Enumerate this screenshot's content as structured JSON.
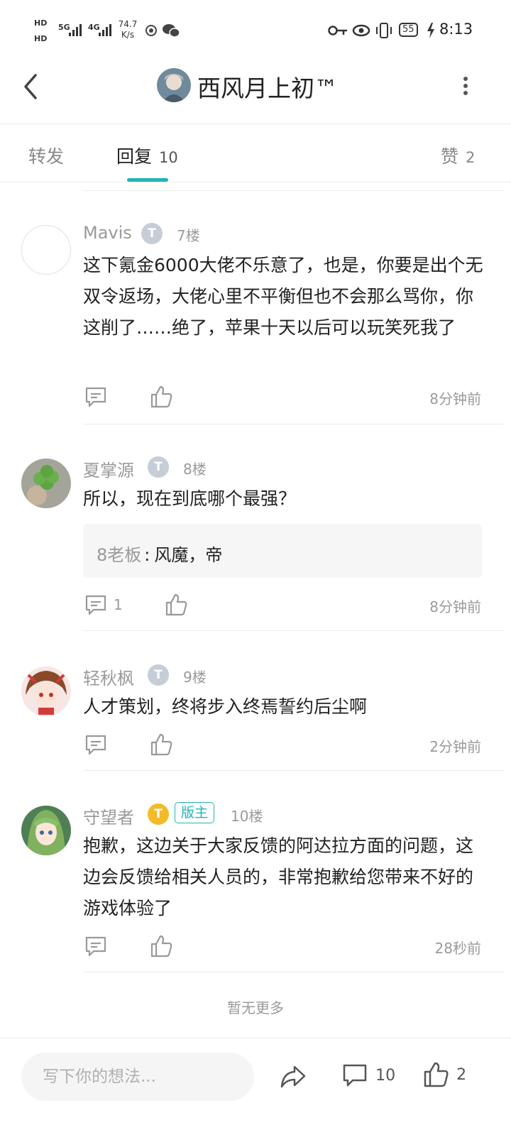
{
  "status_bar": {
    "hd1": "HD",
    "hd2": "HD",
    "sig1": "5G",
    "sig2": "4G",
    "speed": "74.7",
    "speed_unit": "K/s",
    "battery": "55",
    "time": "8:13"
  },
  "header": {
    "title": "西风月上初™"
  },
  "tabs": [
    {
      "label": "转发",
      "count": ""
    },
    {
      "label": "回复",
      "count": "10"
    },
    {
      "label": "赞",
      "count": "2"
    }
  ],
  "comments": [
    {
      "user": "Mavis",
      "level": "T",
      "floor": "7楼",
      "text": "这下氪金6000大佬不乐意了，也是，你要是出个无双令返场，大佬心里不平衡但也不会那么骂你，你这削了……绝了，苹果十天以后可以玩笑死我了",
      "reply_count": "",
      "time": "8分钟前"
    },
    {
      "user": "夏掌源",
      "level": "T",
      "floor": "8楼",
      "text": "所以，现在到底哪个最强？",
      "quote_name": "8老板",
      "quote_sep": ":",
      "quote_text": "风魔，帝",
      "reply_count": "1",
      "time": "8分钟前"
    },
    {
      "user": "轻秋枫",
      "level": "T",
      "floor": "9楼",
      "text": "人才策划，终将步入终焉誓约后尘啊",
      "reply_count": "",
      "time": "2分钟前"
    },
    {
      "user": "守望者",
      "level": "T",
      "badge": "版主",
      "floor": "10楼",
      "text": "抱歉，这边关于大家反馈的阿达拉方面的问题，这边会反馈给相关人员的，非常抱歉给您带来不好的游戏体验了",
      "reply_count": "",
      "time": "28秒前"
    }
  ],
  "footer_note": "暂无更多",
  "bottom_bar": {
    "input_placeholder": "写下你的想法...",
    "reply_count": "10",
    "like_count": "2"
  },
  "colors": {
    "accent": "#23b3b6",
    "level_badge": "#c6cdd6",
    "mod_level_badge": "#f3bb27"
  }
}
